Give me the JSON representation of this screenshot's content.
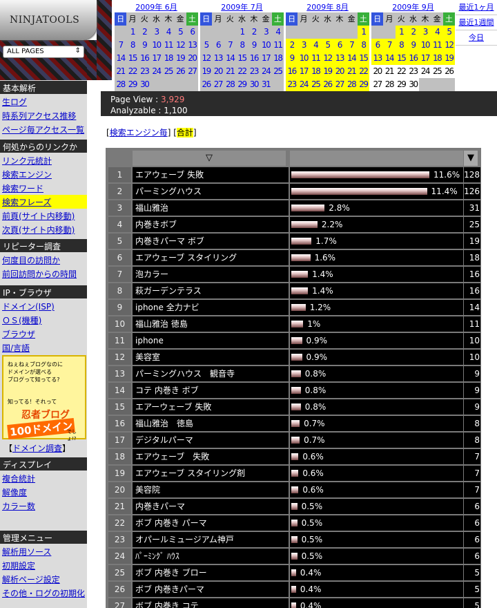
{
  "logo": "NINJATOOLS",
  "page_select": "ALL PAGES",
  "sidebar": {
    "sections": [
      {
        "title": "基本解析",
        "items": [
          "生ログ",
          "時系列アクセス推移",
          "ページ毎アクセス一覧"
        ]
      },
      {
        "title": "何処からのリンクか",
        "items": [
          "リンク元統計",
          "検索エンジン",
          "検索ワード",
          "検索フレーズ",
          "前頁(サイト内移動)",
          "次頁(サイト内移動)"
        ]
      },
      {
        "title": "リピーター調査",
        "items": [
          "何度目の訪問か",
          "前回訪問からの時間"
        ]
      },
      {
        "title": "IP・ブラウザ",
        "items": [
          "ドメイン(ISP)",
          "ＯＳ(機種)",
          "ブラウザ",
          "国/言語"
        ]
      },
      {
        "title": "ディスプレイ",
        "items": [
          "複合統計",
          "解像度",
          "カラー数"
        ]
      },
      {
        "title": "管理メニュー",
        "items": [
          "解析用ソース",
          "初期設定",
          "解析ページ設定",
          "その他・ログの初期化"
        ]
      }
    ],
    "active_item": "検索フレーズ",
    "banner": {
      "line1": "ねぇねぇブログなのに",
      "line2": "ドメインが選べる",
      "line3": "ブログって知ってる?",
      "line4": "知ってる！それって",
      "line5": "忍者ブログ",
      "line6": "100ドメイン",
      "line7": "でしょ!?"
    },
    "banner_link": "ドメイン調査"
  },
  "weekdays": [
    "日",
    "月",
    "火",
    "水",
    "木",
    "金",
    "土"
  ],
  "calendars": [
    {
      "title": "2009年 6月",
      "weeks": [
        [
          "",
          "1",
          "2",
          "3",
          "4",
          "5",
          "6"
        ],
        [
          "7",
          "8",
          "9",
          "10",
          "11",
          "12",
          "13"
        ],
        [
          "14",
          "15",
          "16",
          "17",
          "18",
          "19",
          "20"
        ],
        [
          "21",
          "22",
          "23",
          "24",
          "25",
          "26",
          "27"
        ],
        [
          "28",
          "29",
          "30",
          "",
          "",
          "",
          ""
        ]
      ]
    },
    {
      "title": "2009年 7月",
      "weeks": [
        [
          "",
          "",
          "",
          "1",
          "2",
          "3",
          "4"
        ],
        [
          "5",
          "6",
          "7",
          "8",
          "9",
          "10",
          "11"
        ],
        [
          "12",
          "13",
          "14",
          "15",
          "16",
          "17",
          "18"
        ],
        [
          "19",
          "20",
          "21",
          "22",
          "23",
          "24",
          "25"
        ],
        [
          "26",
          "27",
          "28",
          "29",
          "30",
          "31",
          ""
        ]
      ]
    },
    {
      "title": "2009年 8月",
      "weeks": [
        [
          "",
          "",
          "",
          "",
          "",
          "",
          "1"
        ],
        [
          "2",
          "3",
          "4",
          "5",
          "6",
          "7",
          "8"
        ],
        [
          "9",
          "10",
          "11",
          "12",
          "13",
          "14",
          "15"
        ],
        [
          "16",
          "17",
          "18",
          "19",
          "20",
          "21",
          "22"
        ],
        [
          "23",
          "24",
          "25",
          "26",
          "27",
          "28",
          "29"
        ]
      ]
    },
    {
      "title": "2009年 9月",
      "weeks": [
        [
          "",
          "",
          "1",
          "2",
          "3",
          "4",
          "5"
        ],
        [
          "6",
          "7",
          "8",
          "9",
          "10",
          "11",
          "12"
        ],
        [
          "13",
          "14",
          "15",
          "16",
          "17",
          "18",
          "19"
        ],
        [
          "20",
          "21",
          "22",
          "23",
          "24",
          "25",
          "26"
        ],
        [
          "27",
          "28",
          "29",
          "30",
          "",
          "",
          ""
        ]
      ]
    }
  ],
  "range_links": [
    "最近1ヶ月",
    "最近1週間",
    "今日"
  ],
  "stats": {
    "page_view_label": "Page View : ",
    "page_view": "3,929",
    "analyzable_label": "Analyzable : ",
    "analyzable": "1,100"
  },
  "tabs": {
    "engine": "検索エンジン毎",
    "total": "合計"
  },
  "table": {
    "sort_keyword": "▽",
    "sort_count": "▼",
    "rows": [
      {
        "rank": "1",
        "phrase": "エアウェーブ 失敗",
        "pct": "11.6%",
        "share": 11.6,
        "count": "128"
      },
      {
        "rank": "2",
        "phrase": "パーミングハウス",
        "pct": "11.4%",
        "share": 11.4,
        "count": "126"
      },
      {
        "rank": "3",
        "phrase": "福山雅治",
        "pct": "2.8%",
        "share": 2.8,
        "count": "31"
      },
      {
        "rank": "4",
        "phrase": "内巻きボブ",
        "pct": "2.2%",
        "share": 2.2,
        "count": "25"
      },
      {
        "rank": "5",
        "phrase": "内巻きパーマ ボブ",
        "pct": "1.7%",
        "share": 1.7,
        "count": "19"
      },
      {
        "rank": "6",
        "phrase": "エアウェーブ スタイリング",
        "pct": "1.6%",
        "share": 1.6,
        "count": "18"
      },
      {
        "rank": "7",
        "phrase": "泡カラー",
        "pct": "1.4%",
        "share": 1.4,
        "count": "16"
      },
      {
        "rank": "8",
        "phrase": "萩ガーデンテラス",
        "pct": "1.4%",
        "share": 1.4,
        "count": "16"
      },
      {
        "rank": "9",
        "phrase": "iphone 全力ナビ",
        "pct": "1.2%",
        "share": 1.2,
        "count": "14"
      },
      {
        "rank": "10",
        "phrase": "福山雅治 徳島",
        "pct": "1%",
        "share": 1.0,
        "count": "11"
      },
      {
        "rank": "11",
        "phrase": "iphone",
        "pct": "0.9%",
        "share": 0.9,
        "count": "10"
      },
      {
        "rank": "12",
        "phrase": "美容室",
        "pct": "0.9%",
        "share": 0.9,
        "count": "10"
      },
      {
        "rank": "13",
        "phrase": "パーミングハウス　観音寺",
        "pct": "0.8%",
        "share": 0.8,
        "count": "9"
      },
      {
        "rank": "14",
        "phrase": "コテ 内巻き ボブ",
        "pct": "0.8%",
        "share": 0.8,
        "count": "9"
      },
      {
        "rank": "15",
        "phrase": "エアーウェーブ 失敗",
        "pct": "0.8%",
        "share": 0.8,
        "count": "9"
      },
      {
        "rank": "16",
        "phrase": "福山雅治　徳島",
        "pct": "0.7%",
        "share": 0.7,
        "count": "8"
      },
      {
        "rank": "17",
        "phrase": "デジタルパーマ",
        "pct": "0.7%",
        "share": 0.7,
        "count": "8"
      },
      {
        "rank": "18",
        "phrase": "エアウェーブ　失敗",
        "pct": "0.6%",
        "share": 0.6,
        "count": "7"
      },
      {
        "rank": "19",
        "phrase": "エアウェーブ スタイリング剤",
        "pct": "0.6%",
        "share": 0.6,
        "count": "7"
      },
      {
        "rank": "20",
        "phrase": "美容院",
        "pct": "0.6%",
        "share": 0.6,
        "count": "7"
      },
      {
        "rank": "21",
        "phrase": "内巻きパーマ",
        "pct": "0.5%",
        "share": 0.5,
        "count": "6"
      },
      {
        "rank": "22",
        "phrase": "ボブ 内巻き パーマ",
        "pct": "0.5%",
        "share": 0.5,
        "count": "6"
      },
      {
        "rank": "23",
        "phrase": "オパールミュージアム神戸",
        "pct": "0.5%",
        "share": 0.5,
        "count": "6"
      },
      {
        "rank": "24",
        "phrase": "ﾊﾟｰﾐﾝｸﾞ ﾊｳｽ",
        "pct": "0.5%",
        "share": 0.5,
        "count": "6"
      },
      {
        "rank": "25",
        "phrase": "ボブ 内巻き ブロー",
        "pct": "0.4%",
        "share": 0.4,
        "count": "5"
      },
      {
        "rank": "26",
        "phrase": "ボブ 内巻きパーマ",
        "pct": "0.4%",
        "share": 0.4,
        "count": "5"
      },
      {
        "rank": "27",
        "phrase": "ボブ 内巻き コテ",
        "pct": "0.4%",
        "share": 0.4,
        "count": "5"
      }
    ]
  }
}
